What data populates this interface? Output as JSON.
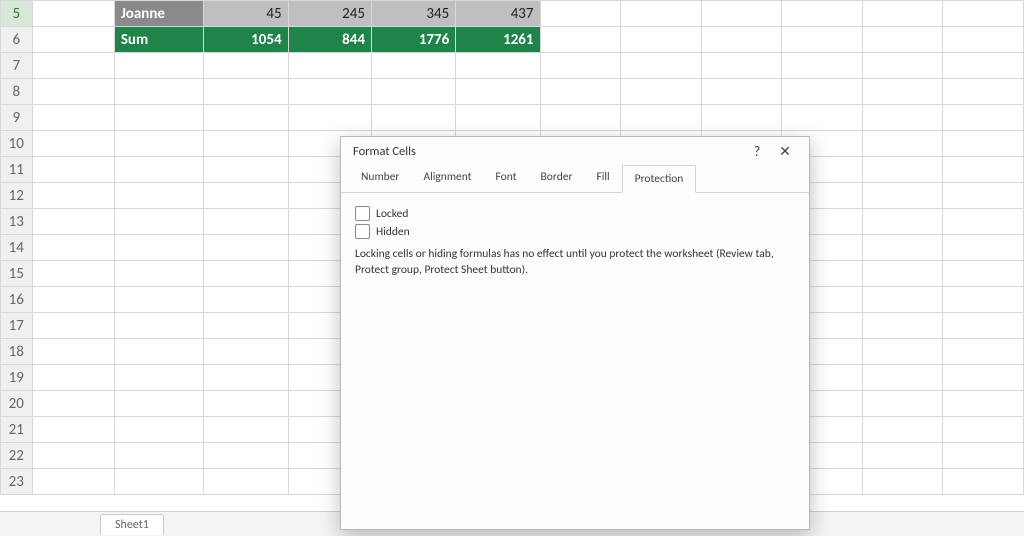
{
  "rows": {
    "visible_start": 5,
    "visible_end": 23,
    "data": [
      {
        "n": 5,
        "style": "grey",
        "name": "Joanne",
        "c": [
          45,
          245,
          345,
          437
        ]
      },
      {
        "n": 6,
        "style": "green",
        "name": "Sum",
        "c": [
          1054,
          844,
          1776,
          1261
        ]
      }
    ]
  },
  "sheet_tab": "Sheet1",
  "dialog": {
    "title": "Format Cells",
    "help": "?",
    "close": "✕",
    "tabs": [
      "Number",
      "Alignment",
      "Font",
      "Border",
      "Fill",
      "Protection"
    ],
    "active_tab": 5,
    "locked_label": "Locked",
    "hidden_label": "Hidden",
    "note": "Locking cells or hiding formulas has no effect until you protect the worksheet (Review tab, Protect group, Protect Sheet button)."
  }
}
